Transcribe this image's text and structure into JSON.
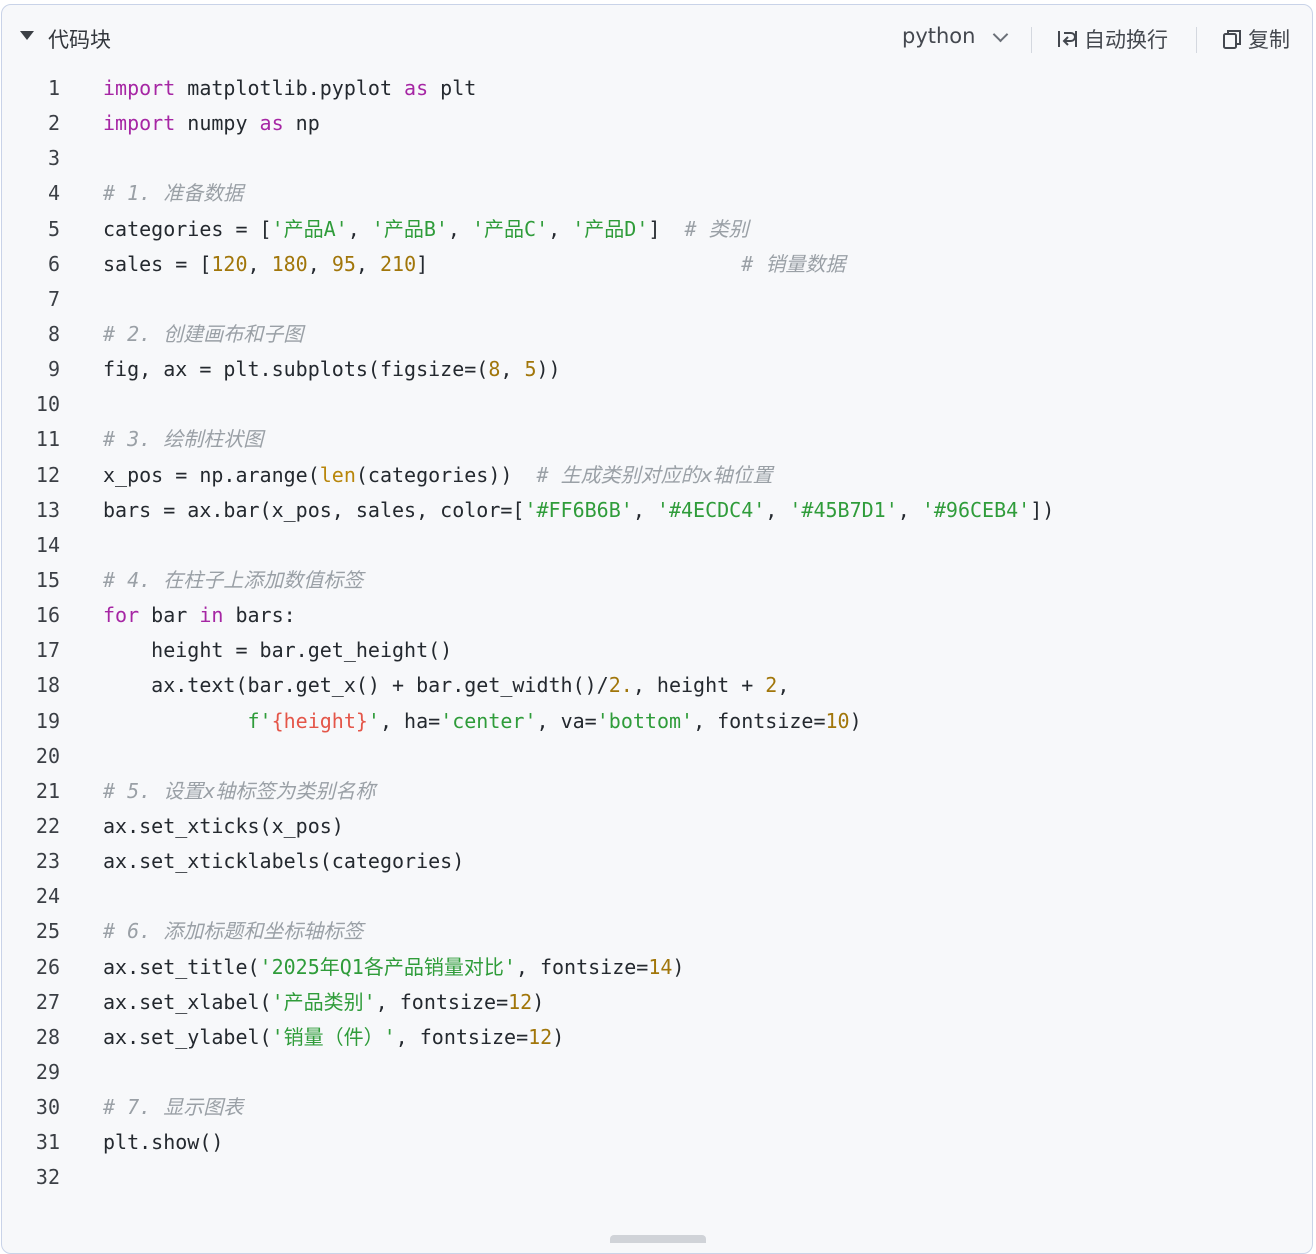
{
  "header": {
    "title": "代码块",
    "language": "python",
    "wrap_label": "自动换行",
    "copy_label": "复制",
    "icons": [
      "collapse-caret-icon",
      "chevron-down-icon",
      "wrap-icon",
      "copy-icon"
    ]
  },
  "code": {
    "language": "python",
    "lines": [
      {
        "n": "1",
        "tokens": [
          {
            "t": "import",
            "c": "kw"
          },
          {
            "t": " matplotlib.pyplot "
          },
          {
            "t": "as",
            "c": "kw"
          },
          {
            "t": " plt"
          }
        ]
      },
      {
        "n": "2",
        "tokens": [
          {
            "t": "import",
            "c": "kw"
          },
          {
            "t": " numpy "
          },
          {
            "t": "as",
            "c": "kw"
          },
          {
            "t": " np"
          }
        ]
      },
      {
        "n": "3",
        "tokens": []
      },
      {
        "n": "4",
        "tokens": [
          {
            "t": "# 1. 准备数据",
            "c": "cm"
          }
        ]
      },
      {
        "n": "5",
        "tokens": [
          {
            "t": "categories = ["
          },
          {
            "t": "'产品A'",
            "c": "str"
          },
          {
            "t": ", "
          },
          {
            "t": "'产品B'",
            "c": "str"
          },
          {
            "t": ", "
          },
          {
            "t": "'产品C'",
            "c": "str"
          },
          {
            "t": ", "
          },
          {
            "t": "'产品D'",
            "c": "str"
          },
          {
            "t": "]  "
          },
          {
            "t": "# 类别",
            "c": "cm"
          }
        ]
      },
      {
        "n": "6",
        "tokens": [
          {
            "t": "sales = ["
          },
          {
            "t": "120",
            "c": "num"
          },
          {
            "t": ", "
          },
          {
            "t": "180",
            "c": "num"
          },
          {
            "t": ", "
          },
          {
            "t": "95",
            "c": "num"
          },
          {
            "t": ", "
          },
          {
            "t": "210",
            "c": "num"
          },
          {
            "t": "]                          "
          },
          {
            "t": "# 销量数据",
            "c": "cm"
          }
        ]
      },
      {
        "n": "7",
        "tokens": []
      },
      {
        "n": "8",
        "tokens": [
          {
            "t": "# 2. 创建画布和子图",
            "c": "cm"
          }
        ]
      },
      {
        "n": "9",
        "tokens": [
          {
            "t": "fig, ax = plt.subplots(figsize=("
          },
          {
            "t": "8",
            "c": "num"
          },
          {
            "t": ", "
          },
          {
            "t": "5",
            "c": "num"
          },
          {
            "t": "))"
          }
        ]
      },
      {
        "n": "10",
        "tokens": []
      },
      {
        "n": "11",
        "tokens": [
          {
            "t": "# 3. 绘制柱状图",
            "c": "cm"
          }
        ]
      },
      {
        "n": "12",
        "tokens": [
          {
            "t": "x_pos = np.arange("
          },
          {
            "t": "len",
            "c": "fn"
          },
          {
            "t": "(categories))  "
          },
          {
            "t": "# 生成类别对应的x轴位置",
            "c": "cm"
          }
        ]
      },
      {
        "n": "13",
        "tokens": [
          {
            "t": "bars = ax.bar(x_pos, sales, color=["
          },
          {
            "t": "'#FF6B6B'",
            "c": "str"
          },
          {
            "t": ", "
          },
          {
            "t": "'#4ECDC4'",
            "c": "str"
          },
          {
            "t": ", "
          },
          {
            "t": "'#45B7D1'",
            "c": "str"
          },
          {
            "t": ", "
          },
          {
            "t": "'#96CEB4'",
            "c": "str"
          },
          {
            "t": "])"
          }
        ]
      },
      {
        "n": "14",
        "tokens": []
      },
      {
        "n": "15",
        "tokens": [
          {
            "t": "# 4. 在柱子上添加数值标签",
            "c": "cm"
          }
        ]
      },
      {
        "n": "16",
        "tokens": [
          {
            "t": "for",
            "c": "kw"
          },
          {
            "t": " bar "
          },
          {
            "t": "in",
            "c": "kw"
          },
          {
            "t": " bars:"
          }
        ]
      },
      {
        "n": "17",
        "tokens": [
          {
            "t": "    height = bar.get_height()"
          }
        ]
      },
      {
        "n": "18",
        "tokens": [
          {
            "t": "    ax.text(bar.get_x() + bar.get_width()/"
          },
          {
            "t": "2.",
            "c": "num"
          },
          {
            "t": ", height + "
          },
          {
            "t": "2",
            "c": "num"
          },
          {
            "t": ","
          }
        ]
      },
      {
        "n": "19",
        "tokens": [
          {
            "t": "            "
          },
          {
            "t": "f'",
            "c": "str"
          },
          {
            "t": "{height}",
            "c": "fstr"
          },
          {
            "t": "'",
            "c": "str"
          },
          {
            "t": ", ha="
          },
          {
            "t": "'center'",
            "c": "str"
          },
          {
            "t": ", va="
          },
          {
            "t": "'bottom'",
            "c": "str"
          },
          {
            "t": ", fontsize="
          },
          {
            "t": "10",
            "c": "num"
          },
          {
            "t": ")"
          }
        ]
      },
      {
        "n": "20",
        "tokens": []
      },
      {
        "n": "21",
        "tokens": [
          {
            "t": "# 5. 设置x轴标签为类别名称",
            "c": "cm"
          }
        ]
      },
      {
        "n": "22",
        "tokens": [
          {
            "t": "ax.set_xticks(x_pos)"
          }
        ]
      },
      {
        "n": "23",
        "tokens": [
          {
            "t": "ax.set_xticklabels(categories)"
          }
        ]
      },
      {
        "n": "24",
        "tokens": []
      },
      {
        "n": "25",
        "tokens": [
          {
            "t": "# 6. 添加标题和坐标轴标签",
            "c": "cm"
          }
        ]
      },
      {
        "n": "26",
        "tokens": [
          {
            "t": "ax.set_title("
          },
          {
            "t": "'2025年Q1各产品销量对比'",
            "c": "str"
          },
          {
            "t": ", fontsize="
          },
          {
            "t": "14",
            "c": "num"
          },
          {
            "t": ")"
          }
        ]
      },
      {
        "n": "27",
        "tokens": [
          {
            "t": "ax.set_xlabel("
          },
          {
            "t": "'产品类别'",
            "c": "str"
          },
          {
            "t": ", fontsize="
          },
          {
            "t": "12",
            "c": "num"
          },
          {
            "t": ")"
          }
        ]
      },
      {
        "n": "28",
        "tokens": [
          {
            "t": "ax.set_ylabel("
          },
          {
            "t": "'销量（件）'",
            "c": "str"
          },
          {
            "t": ", fontsize="
          },
          {
            "t": "12",
            "c": "num"
          },
          {
            "t": ")"
          }
        ]
      },
      {
        "n": "29",
        "tokens": []
      },
      {
        "n": "30",
        "tokens": [
          {
            "t": "# 7. 显示图表",
            "c": "cm"
          }
        ]
      },
      {
        "n": "31",
        "tokens": [
          {
            "t": "plt.show()"
          }
        ]
      },
      {
        "n": "32",
        "tokens": []
      }
    ]
  },
  "colors": {
    "keyword": "#a626a4",
    "string": "#2f9c3a",
    "number": "#a1760a",
    "builtin": "#b8860b",
    "comment": "#9aa0a6",
    "fstring_expr": "#e45649",
    "background": "#f7f8fa",
    "border": "#c9d3e8"
  }
}
